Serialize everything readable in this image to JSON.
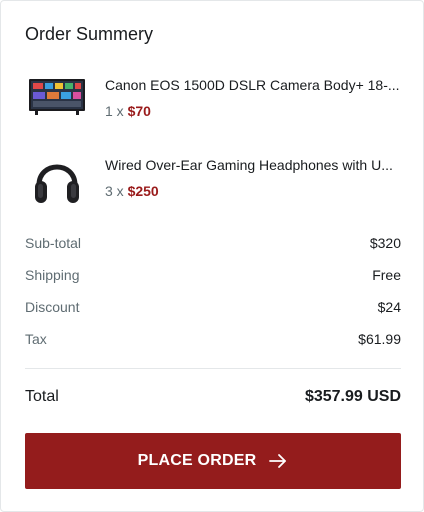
{
  "summary": {
    "title": "Order Summery"
  },
  "items": [
    {
      "name": "Canon EOS 1500D DSLR Camera Body+ 18-...",
      "qty": "1 x",
      "price": "$70",
      "icon": "tv-thumbnail"
    },
    {
      "name": "Wired Over-Ear Gaming Headphones with U...",
      "qty": "3 x",
      "price": "$250",
      "icon": "headphones-thumbnail"
    }
  ],
  "totals": {
    "subtotal": {
      "label": "Sub-total",
      "value": "$320"
    },
    "shipping": {
      "label": "Shipping",
      "value": "Free"
    },
    "discount": {
      "label": "Discount",
      "value": "$24"
    },
    "tax": {
      "label": "Tax",
      "value": "$61.99"
    },
    "total": {
      "label": "Total",
      "value": "$357.99 USD"
    }
  },
  "button": {
    "label": "PLACE ORDER",
    "icon": "arrow-right-icon"
  },
  "colors": {
    "accent": "#941c1c",
    "price": "#9a1b1b",
    "muted": "#5f6c72",
    "text": "#191c1f",
    "border": "#e4e7e9"
  }
}
